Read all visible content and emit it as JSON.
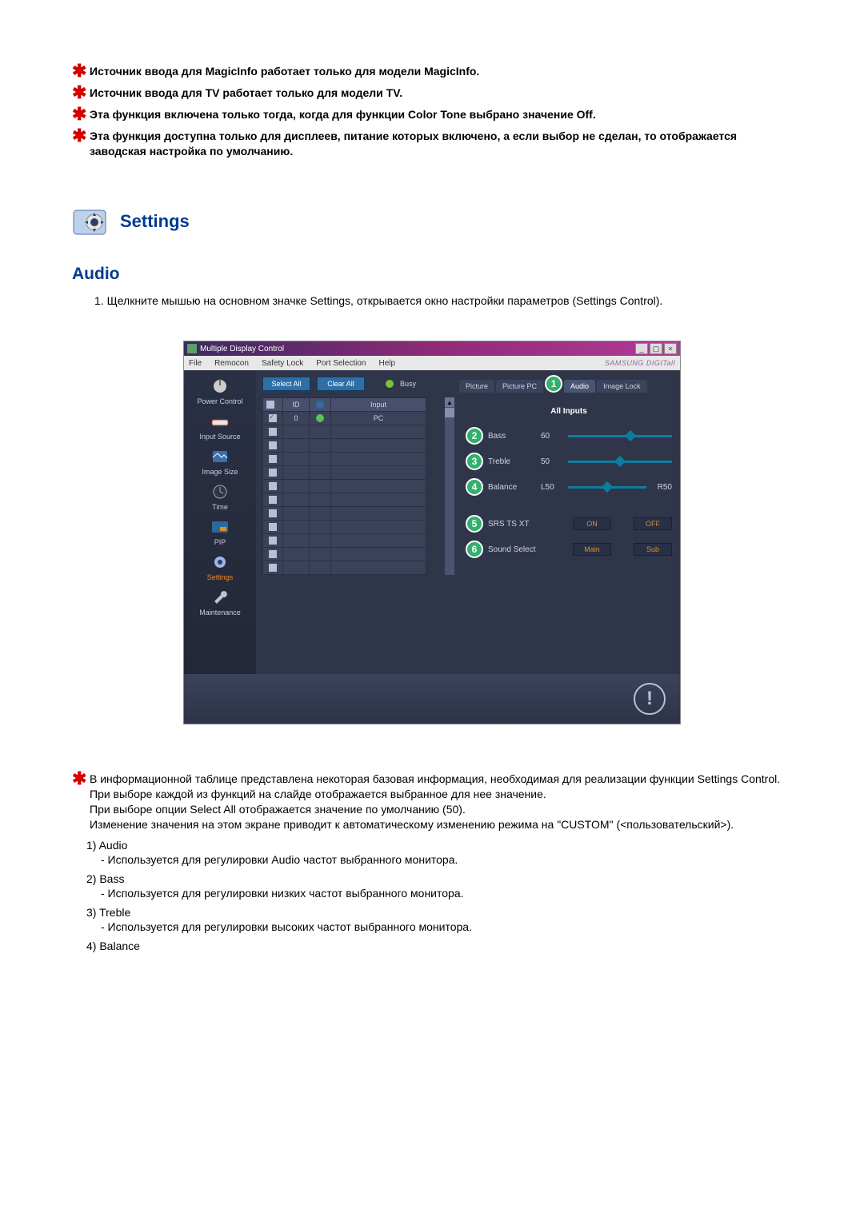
{
  "top_notes": [
    "Источник ввода для MagicInfo работает только для модели MagicInfo.",
    "Источник ввода для TV работает только для модели TV.",
    "Эта функция включена только тогда, когда для функции Color Tone выбрано значение Off.",
    "Эта функция доступна только для дисплеев, питание которых включено, а если выбор не сделан, то отображается заводская настройка по умолчанию."
  ],
  "section_header": "Settings",
  "audio_heading": "Audio",
  "step1": "Щелкните мышью на основном значке Settings, открывается окно настройки параметров (Settings Control).",
  "app": {
    "title": "Multiple Display Control",
    "menu": [
      "File",
      "Remocon",
      "Safety Lock",
      "Port Selection",
      "Help"
    ],
    "brand": "SAMSUNG DIGITall",
    "toolbar": {
      "select_all": "Select All",
      "clear_all": "Clear All",
      "busy": "Busy"
    },
    "sidebar": [
      "Power Control",
      "Input Source",
      "Image Size",
      "Time",
      "PIP",
      "Settings",
      "Maintenance"
    ],
    "active_sidebar": "Settings",
    "grid": {
      "headers": {
        "chk": "",
        "id": "ID",
        "status": "",
        "input": "Input"
      },
      "rows": [
        {
          "checked": true,
          "id": "0",
          "status": "green",
          "input": "PC"
        },
        {
          "checked": false,
          "id": "",
          "status": "",
          "input": ""
        },
        {
          "checked": false,
          "id": "",
          "status": "",
          "input": ""
        },
        {
          "checked": false,
          "id": "",
          "status": "",
          "input": ""
        },
        {
          "checked": false,
          "id": "",
          "status": "",
          "input": ""
        },
        {
          "checked": false,
          "id": "",
          "status": "",
          "input": ""
        },
        {
          "checked": false,
          "id": "",
          "status": "",
          "input": ""
        },
        {
          "checked": false,
          "id": "",
          "status": "",
          "input": ""
        },
        {
          "checked": false,
          "id": "",
          "status": "",
          "input": ""
        },
        {
          "checked": false,
          "id": "",
          "status": "",
          "input": ""
        },
        {
          "checked": false,
          "id": "",
          "status": "",
          "input": ""
        },
        {
          "checked": false,
          "id": "",
          "status": "",
          "input": ""
        }
      ]
    },
    "tabs": [
      "Picture",
      "Picture PC",
      "Audio",
      "Image Lock"
    ],
    "active_tab": "Audio",
    "all_inputs": "All Inputs",
    "sliders": {
      "bass": {
        "label": "Bass",
        "value": "60",
        "pos": 60
      },
      "treble": {
        "label": "Treble",
        "value": "50",
        "pos": 50
      },
      "balance": {
        "label": "Balance",
        "left": "L50",
        "right": "R50",
        "pos": 50
      }
    },
    "toggles": {
      "srs": {
        "label": "SRS TS XT",
        "on": "ON",
        "off": "OFF"
      },
      "sound": {
        "label": "Sound Select",
        "main": "Main",
        "sub": "Sub"
      }
    },
    "callouts": [
      "1",
      "2",
      "3",
      "4",
      "5",
      "6"
    ]
  },
  "post_note": "В информационной таблице представлена некоторая базовая информация, необходимая для реализации функции Settings Control. При выборе каждой из функций на слайде отображается выбранное для нее значение.\nПри выборе опции Select All отображается значение по умолчанию (50).\nИзменение значения на этом экране приводит к автоматическому изменению режима на \"CUSTOM\" (<пользовательский>).",
  "items": [
    {
      "num": "1)",
      "title": "Audio",
      "desc": "- Используется для регулировки Audio частот выбранного монитора."
    },
    {
      "num": "2)",
      "title": "Bass",
      "desc": "- Используется для регулировки низких частот выбранного монитора."
    },
    {
      "num": "3)",
      "title": "Treble",
      "desc": "- Используется для регулировки высоких частот выбранного монитора."
    },
    {
      "num": "4)",
      "title": "Balance",
      "desc": ""
    }
  ]
}
